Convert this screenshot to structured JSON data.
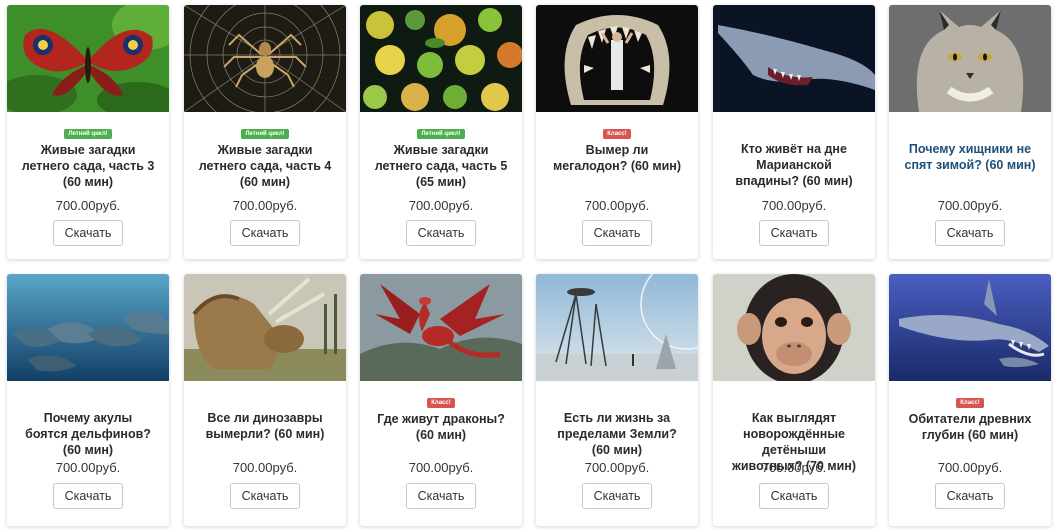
{
  "products": [
    {
      "badge": "Летний цикл!",
      "badge_color": "green",
      "title": "Живые загадки летнего сада, часть 3 (60 мин)",
      "price": "700.00руб.",
      "button": "Скачать",
      "image": "butterfly-photo"
    },
    {
      "badge": "Летний цикл!",
      "badge_color": "green",
      "title": "Живые загадки летнего сада, часть 4 (60 мин)",
      "price": "700.00руб.",
      "button": "Скачать",
      "image": "spider-photo"
    },
    {
      "badge": "Летний цикл!",
      "badge_color": "green",
      "title": "Живые загадки летнего сада, часть 5 (65 мин)",
      "price": "700.00руб.",
      "button": "Скачать",
      "image": "pollen-photo"
    },
    {
      "badge": "Класс!",
      "badge_color": "red",
      "title": "Вымер ли мегалодон? (60 мин)",
      "price": "700.00руб.",
      "button": "Скачать",
      "image": "megalodon-jaws-photo"
    },
    {
      "badge": "",
      "badge_color": "",
      "title": "Кто живёт на дне Марианской впадины? (60 мин)",
      "price": "700.00руб.",
      "button": "Скачать",
      "image": "goblin-shark-photo"
    },
    {
      "badge": "",
      "badge_color": "",
      "title": "Почему хищники не спят зимой? (60 мин)",
      "price": "700.00руб.",
      "button": "Скачать",
      "image": "lynx-photo"
    },
    {
      "badge": "",
      "badge_color": "",
      "title": "Почему акулы боятся дельфинов? (60 мин)",
      "price": "700.00руб.",
      "button": "Скачать",
      "image": "dolphins-photo"
    },
    {
      "badge": "",
      "badge_color": "",
      "title": "Все ли динозавры вымерли? (60 мин)",
      "price": "700.00руб.",
      "button": "Скачать",
      "image": "triceratops-illustration"
    },
    {
      "badge": "Класс!",
      "badge_color": "red",
      "title": "Где живут драконы? (60 мин)",
      "price": "700.00руб.",
      "button": "Скачать",
      "image": "dragon-illustration"
    },
    {
      "badge": "",
      "badge_color": "",
      "title": "Есть ли жизнь за пределами Земли? (60 мин)",
      "price": "700.00руб.",
      "button": "Скачать",
      "image": "alien-planet-illustration"
    },
    {
      "badge": "",
      "badge_color": "",
      "title": "Как выглядят новорождённые детёныши животных? (70 мин)",
      "price": "700.00руб.",
      "button": "Скачать",
      "image": "baby-chimp-photo"
    },
    {
      "badge": "Класс!",
      "badge_color": "red",
      "title": "Обитатели древних глубин (60 мин)",
      "price": "700.00руб.",
      "button": "Скачать",
      "image": "prehistoric-shark-illustration"
    }
  ],
  "colors": {
    "badge_green": "#4cae4c",
    "badge_red": "#d9534f",
    "link_title": "#1f4e79"
  }
}
